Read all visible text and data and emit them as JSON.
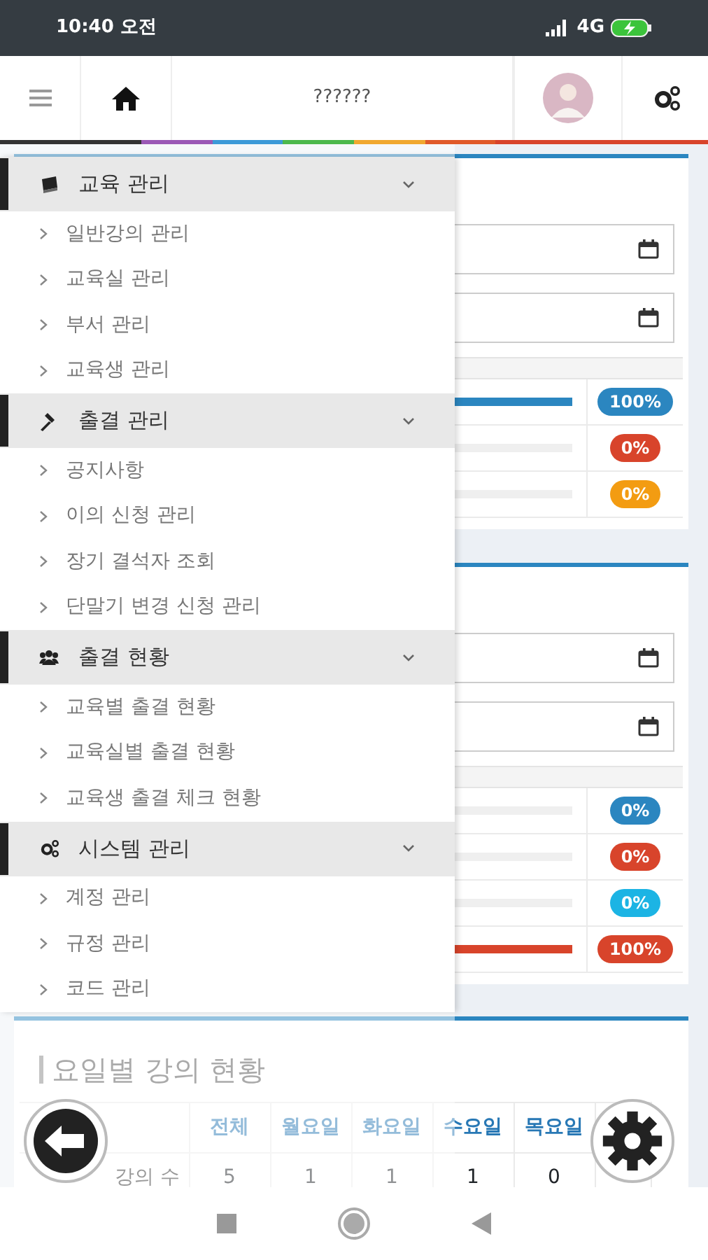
{
  "status_bar": {
    "time": "10:40 오전",
    "network": "4G"
  },
  "header": {
    "title": "??????"
  },
  "drawer": {
    "sections": [
      {
        "title": "교육 관리",
        "expanded": true,
        "items": [
          "일반강의 관리",
          "교육실 관리",
          "부서 관리",
          "교육생 관리"
        ]
      },
      {
        "title": "출결 관리",
        "expanded": true,
        "items": [
          "공지사항",
          "이의 신청 관리",
          "장기 결석자 조회",
          "단말기 변경 신청 관리"
        ]
      },
      {
        "title": "출결 현황",
        "expanded": true,
        "items": [
          "교육별 출결 현황",
          "교육실별 출결 현황",
          "교육생 출결 체크 현황"
        ]
      },
      {
        "title": "시스템 관리",
        "expanded": true,
        "items": [
          "계정 관리",
          "규정 관리",
          "코드 관리"
        ]
      }
    ]
  },
  "cards": [
    {
      "rows": [
        {
          "level": 1,
          "badge": "100%",
          "color": "#2b86c0"
        },
        {
          "level": 0,
          "badge": "0%",
          "color": "#d8442b"
        },
        {
          "level": 0,
          "badge": "0%",
          "color": "#f39c12"
        }
      ]
    },
    {
      "rows": [
        {
          "level": 0,
          "badge": "0%",
          "color": "#2b86c0"
        },
        {
          "level": 0,
          "badge": "0%",
          "color": "#d8442b"
        },
        {
          "level": 0,
          "badge": "0%",
          "color": "#1cb4e4"
        },
        {
          "level": 1,
          "badge": "100%",
          "color": "#d8442b"
        }
      ]
    }
  ],
  "weekday_card": {
    "title": "요일별 강의 현황",
    "columns": [
      "전체",
      "월요일",
      "화요일",
      "수요일",
      "목요일"
    ],
    "rows": [
      {
        "label": "강의 수",
        "values": [
          "5",
          "1",
          "1",
          "1",
          "0"
        ]
      }
    ]
  }
}
